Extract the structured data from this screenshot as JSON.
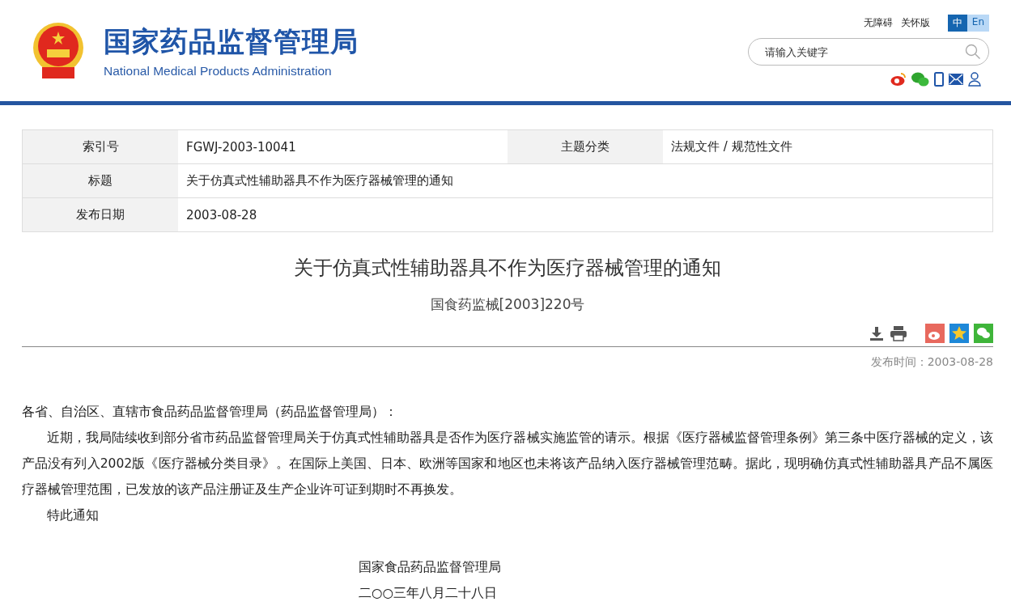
{
  "header": {
    "title": "国家药品监督管理局",
    "subtitle": "National Medical Products Administration",
    "links": [
      "无障碍",
      "关怀版"
    ],
    "languages": [
      {
        "label": "中",
        "selected": true
      },
      {
        "label": "En",
        "selected": false
      }
    ],
    "search": {
      "placeholder": "请输入关键字"
    }
  },
  "meta": {
    "rows": [
      [
        {
          "label": "索引号",
          "value": "FGWJ-2003-10041"
        },
        {
          "label": "主题分类",
          "value": "法规文件 / 规范性文件"
        }
      ],
      [
        {
          "label": "标题",
          "value": "关于仿真式性辅助器具不作为医疗器械管理的通知"
        }
      ],
      [
        {
          "label": "发布日期",
          "value": "2003-08-28"
        }
      ]
    ]
  },
  "article": {
    "title": "关于仿真式性辅助器具不作为医疗器械管理的通知",
    "doc_number": "国食药监械[2003]220号",
    "publish_time": "发布时间：2003-08-28",
    "salutation": "各省、自治区、直辖市食品药品监督管理局（药品监督管理局）：",
    "paragraphs": [
      "近期，我局陆续收到部分省市药品监督管理局关于仿真式性辅助器具是否作为医疗器械实施监管的请示。根据《医疗器械监督管理条例》第三条中医疗器械的定义，该产品没有列入2002版《医疗器械分类目录》。在国际上美国、日本、欧洲等国家和地区也未将该产品纳入医疗器械管理范畴。据此，现明确仿真式性辅助器具产品不属医疗器械管理范围，已发放的该产品注册证及生产企业许可证到期时不再换发。",
      "特此通知"
    ],
    "signature": "国家食品药品监督管理局",
    "date": "二○○三年八月二十八日"
  }
}
